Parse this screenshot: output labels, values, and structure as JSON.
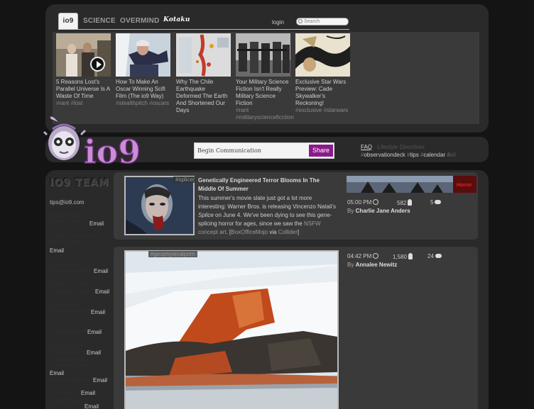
{
  "tabs": [
    "io9",
    "SCIENCE",
    "OVERMIND",
    "Kotaku"
  ],
  "header": {
    "login": "login",
    "search_placeholder": "Search"
  },
  "stories": [
    {
      "title": "5 Reasons Lost's Parallel Universe Is A Waste Of Time",
      "tags": [
        "#rant",
        "#lost"
      ]
    },
    {
      "title": "How To Make An Oscar Winning Scifi Film (The io9 Way)",
      "tags": [
        "#stealthpitch",
        "#oscars"
      ]
    },
    {
      "title": "Why The Chile Earthquake Deformed The Earth And Shortened Our Days",
      "tags": []
    },
    {
      "title": "Your Military Science Fiction Isn't Really Military Science Fiction",
      "tags": [
        "#rant",
        "#militaryscienceficction"
      ]
    },
    {
      "title": "Exclusive Star Wars Preview: Cade Skywalker's Reckoning!",
      "tags": [
        "#exclusive",
        "#starwars"
      ]
    }
  ],
  "communicate": {
    "placeholder": "Begin Communication",
    "share": "Share"
  },
  "faq": {
    "link": "FAQ",
    "rest": "· Lifestyle Directives",
    "tags": [
      "#observationdeck",
      "#tips",
      "#calendar",
      "#all"
    ]
  },
  "team": {
    "heading": "IO9 TEAM",
    "email": "tips@io9.com",
    "rows": [
      {
        "ghost": "Annalee Newitz",
        "ghost2": "Editor-in-Chief",
        "link": "Email"
      },
      {
        "ghost": "Charlie Jane Anders",
        "ghost2": "Managing Editor",
        "link": "Email"
      },
      {
        "ghost": "Alasdair Wilkins",
        "ghost2": "Contributing Editor",
        "link": "Email"
      },
      {
        "ghost": "Esther Inglis-Arkell",
        "ghost2": "Contributing Editor",
        "link": "Email"
      },
      {
        "ghost": "Lauren Davis",
        "ghost2": "Contributing Editor",
        "link": "Email"
      },
      {
        "ghost": "Robert T. Gonzalez",
        "ghost2": "Contributing Editor",
        "link": "Email"
      },
      {
        "ghost": "Keith Veronese",
        "ghost2": "Contributing Editor",
        "link": "Email"
      },
      {
        "ghost": "Cyriaque Lamar",
        "ghost2": "Contributing Editor",
        "link": "Email"
      },
      {
        "ghost": "Meredith Woerner",
        "ghost2": "Staff Writer",
        "link": "Email"
      },
      {
        "ghost": "Jesus Diaz",
        "ghost2": "Editor",
        "link": "Email"
      },
      {
        "ghost": "Gawker Media",
        "ghost2": "",
        "link": "Email"
      }
    ]
  },
  "articles": [
    {
      "tag": "#splice",
      "title": "Genetically Engineered Terror Blooms In The Middle Of Summer",
      "body_pre": "This summer's movie slate just got a lot more interesting: Warner Bros. is releasing Vincenzo Natali's ",
      "body_em": "Splice",
      "body_mid": " on June 4. We've been dying to see this gene-splicing horror for ages, since we saw the ",
      "body_link1": "NSFW concept art",
      "body_mid2": ". [",
      "body_link2": "BoxOfficeMojo",
      "body_via": " via ",
      "body_link3": "Collider",
      "body_end": "]",
      "time": "05:00 PM",
      "views": "582",
      "comments": "5",
      "author_prefix": "By",
      "author": "Charlie Jane Anders",
      "related_label": "Horror"
    },
    {
      "tag": "#geophysicalporn",
      "time": "04:42 PM",
      "views": "1,580",
      "comments": "24",
      "author_prefix": "By",
      "author": "Annalee Newitz"
    }
  ],
  "colors": {
    "accent": "#8b1a8b",
    "panel": "#2a2a2a",
    "card": "#3a3a3a"
  }
}
